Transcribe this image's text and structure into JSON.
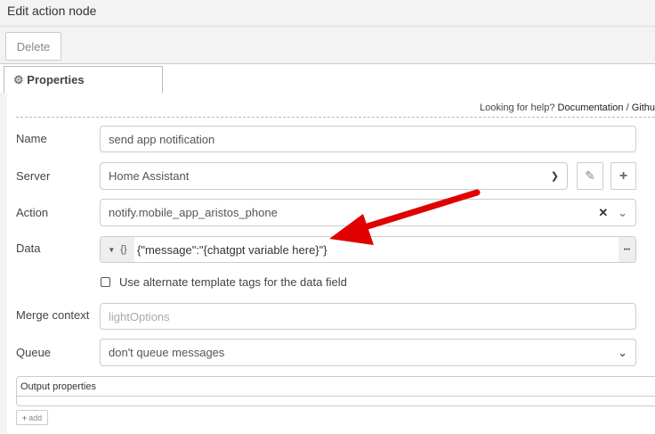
{
  "header": {
    "title": "Edit action node"
  },
  "toolbar": {
    "delete_label": "Delete"
  },
  "tabs": [
    {
      "label": "Properties",
      "icon": "gear-icon"
    }
  ],
  "help": {
    "prompt": "Looking for help?",
    "documentation": "Documentation",
    "separator": "/",
    "github": "Githu"
  },
  "form": {
    "name": {
      "label": "Name",
      "value": "send app notification"
    },
    "server": {
      "label": "Server",
      "value": "Home Assistant"
    },
    "action": {
      "label": "Action",
      "value": "notify.mobile_app_aristos_phone"
    },
    "data": {
      "label": "Data",
      "type_icon": "{}",
      "value": "{\"message\":\"{chatgpt variable here}\"}",
      "more": "•••"
    },
    "alt_tags": {
      "label": "Use alternate template tags for the data field",
      "checked": false
    },
    "merge_context": {
      "label": "Merge context",
      "placeholder": "lightOptions"
    },
    "queue": {
      "label": "Queue",
      "value": "don't queue messages"
    },
    "output_properties": {
      "label": "Output properties"
    },
    "add_label": "add"
  },
  "colors": {
    "arrow": "#e00000"
  }
}
